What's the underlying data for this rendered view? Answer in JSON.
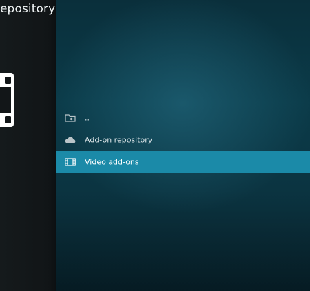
{
  "header": {
    "title": "epository"
  },
  "list": {
    "items": [
      {
        "label": "..",
        "icon": "folder-back-icon"
      },
      {
        "label": "Add-on repository",
        "icon": "cloud-icon"
      },
      {
        "label": "Video add-ons",
        "icon": "film-strip-icon",
        "selected": true
      }
    ]
  },
  "colors": {
    "background": "#0b3b49",
    "left_panel": "#121618",
    "selected_row": "#1b8aa8",
    "text": "#dfe7ea"
  }
}
